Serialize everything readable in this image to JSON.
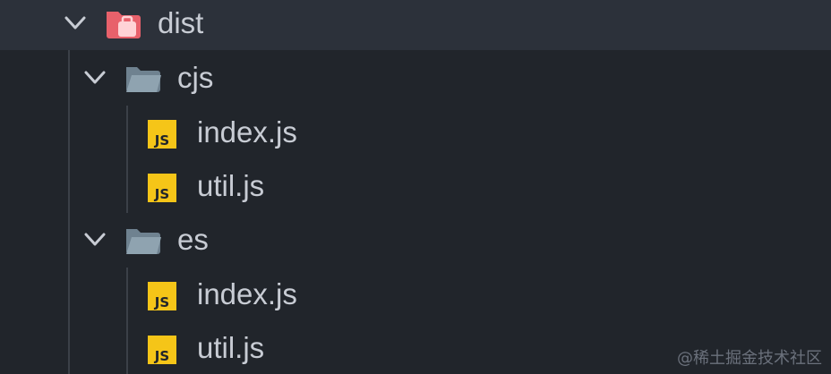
{
  "explorer": {
    "root": {
      "label": "dist",
      "expanded": true,
      "icon": "folder-dist-open-icon",
      "color": "#e8616b"
    },
    "folders": [
      {
        "label": "cjs",
        "expanded": true,
        "icon": "folder-open-icon",
        "files": [
          {
            "label": "index.js",
            "icon": "javascript-file-icon"
          },
          {
            "label": "util.js",
            "icon": "javascript-file-icon"
          }
        ]
      },
      {
        "label": "es",
        "expanded": true,
        "icon": "folder-open-icon",
        "files": [
          {
            "label": "index.js",
            "icon": "javascript-file-icon"
          },
          {
            "label": "util.js",
            "icon": "javascript-file-icon"
          }
        ]
      }
    ]
  },
  "watermark": "@稀土掘金技术社区",
  "colors": {
    "background": "#21252b",
    "selected_row": "#2c313a",
    "text": "#c8ccd4",
    "folder": "#8a9ba8",
    "js_badge": "#f5c518",
    "dist_folder": "#e8616b"
  }
}
